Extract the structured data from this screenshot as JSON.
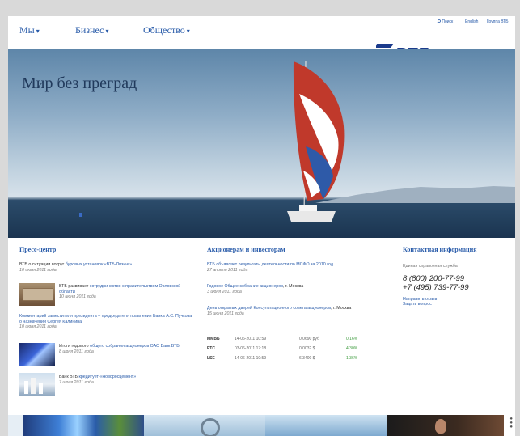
{
  "nav": {
    "menu": [
      {
        "label": "Мы"
      },
      {
        "label": "Бизнес"
      },
      {
        "label": "Общество"
      }
    ],
    "utility": {
      "search": "Поиск",
      "english": "English",
      "group": "Группа ВТБ"
    },
    "logo_text": "ВТБ"
  },
  "hero": {
    "title": "Мир без преград"
  },
  "press": {
    "heading": "Пресс-центр",
    "items": [
      {
        "text": "ВТБ о ситуации вокруг",
        "link": "буровых установок «ВТБ-Лизинг»",
        "date": "10 июня 2011 года"
      },
      {
        "text": "ВТБ развивает",
        "link": "сотрудничество с правительством Орловской области",
        "date": "10 июня 2011 года"
      },
      {
        "text": "",
        "link": "Комментарий заместителя президента – председателя правления Банка А.С. Пучкова о назначении Сергея Калинина",
        "date": "10 июня 2011 года"
      },
      {
        "text": "Итоги годового",
        "link": "общего собрания акционеров ОАО Банк ВТБ",
        "date": "8 июня 2011 года"
      },
      {
        "text": "Банк ВТБ",
        "link": "кредитует «Новоросцемент»",
        "date": "7 июня 2011 года"
      }
    ]
  },
  "investors": {
    "heading": "Акционерам и инвесторам",
    "items": [
      {
        "link": "ВТБ объявляет результаты деятельности по МСФО за 2010 год",
        "date": "27 апреля 2011 года"
      },
      {
        "link": "Годовое Общее собрание акционеров",
        "text": ", г. Москва",
        "date": "3 июня 2011 года"
      },
      {
        "link": "День открытых дверей Консультационного совета акционеров",
        "text": ", г. Москва",
        "date": "15 июня 2011 года"
      }
    ],
    "quotes": [
      {
        "exchange": "ММВБ",
        "date": "14-06-2011 10:59",
        "price": "0,0690 руб",
        "change": "0,16%"
      },
      {
        "exchange": "РТС",
        "date": "03-06-2011 17:18",
        "price": "0,0032 $",
        "change": "4,30%"
      },
      {
        "exchange": "LSE",
        "date": "14-06-2011 10:59",
        "price": "6,3400 $",
        "change": "1,36%"
      }
    ]
  },
  "contacts": {
    "heading": "Контактная информация",
    "subtitle": "Единая справочная служба",
    "phone1": "8 (800) 200-77-99",
    "phone2": "+7 (495) 739-77-99",
    "link1": "Направить отзыв",
    "link2": "Задать вопрос"
  },
  "colors": {
    "brand_blue": "#2a5caa",
    "logo_blue": "#1b3b8c",
    "positive_green": "#3a9a3a"
  }
}
